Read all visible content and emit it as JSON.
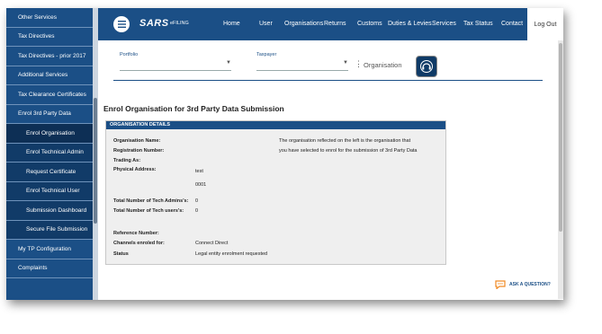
{
  "sidebar": {
    "items": [
      {
        "label": "Other Services",
        "sub": false
      },
      {
        "label": "Tax Directives",
        "sub": false
      },
      {
        "label": "Tax Directives - prior 2017",
        "sub": false
      },
      {
        "label": "Additional Services",
        "sub": false
      },
      {
        "label": "Tax Clearance Certificates",
        "sub": false
      },
      {
        "label": "Enrol 3rd Party Data",
        "sub": false
      },
      {
        "label": "Enrol Organisation",
        "sub": true,
        "active": true
      },
      {
        "label": "Enrol Technical Admin",
        "sub": true
      },
      {
        "label": "Request Certificate",
        "sub": true
      },
      {
        "label": "Enrol Technical User",
        "sub": true
      },
      {
        "label": "Submission Dashboard",
        "sub": true
      },
      {
        "label": "Secure File Submission",
        "sub": true
      },
      {
        "label": "My TP Configuration",
        "sub": false
      },
      {
        "label": "Complaints",
        "sub": false
      }
    ]
  },
  "header": {
    "logo": "SARS",
    "efiling": "eFILING",
    "nav": [
      "Home",
      "User",
      "Organisations",
      "Returns",
      "Customs",
      "Duties & Levies",
      "Services",
      "Tax Status",
      "Contact"
    ],
    "logout": "Log Out"
  },
  "selectors": {
    "portfolio_label": "Portfolio",
    "taxpayer_label": "Taxpayer",
    "organisation_label": "Organisation"
  },
  "main": {
    "title": "Enrol Organisation for 3rd Party Data Submission",
    "panel_title": "ORGANISATION DETAILS",
    "note_line1": "The organisation reflected on the left is the organisation that",
    "note_line2": "you have selected to enrol for the submission of 3rd Party Data",
    "fields": {
      "org_name_label": "Organisation Name:",
      "reg_label": "Registration Number:",
      "trading_label": "Trading As:",
      "physical_label": "Physical Address:",
      "physical_line1": "test",
      "physical_line2": "0001",
      "admins_label": "Total Number of Tech Admins's:",
      "admins_value": "0",
      "users_label": "Total Number of Tech users's:",
      "users_value": "0",
      "ref_label": "Reference Number:",
      "channels_label": "Channels enroled for:",
      "channels_value": "Connect Direct",
      "status_label": "Status",
      "status_value": "Legal entity enrolment requested"
    },
    "ask": "ASK A QUESTION?"
  },
  "colors": {
    "brand": "#1b4f86",
    "ask_icon": "#f08a24"
  }
}
